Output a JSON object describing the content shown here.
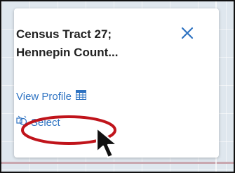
{
  "popup": {
    "title_line1": "Census Tract 27;",
    "title_line2": "Hennepin Count...",
    "close_icon": "close-icon",
    "view_profile_label": "View Profile",
    "view_profile_icon": "table-icon",
    "select_label": "Select",
    "select_icon": "select-features-icon"
  },
  "colors": {
    "link": "#2e73c2",
    "annotation": "#c0141b",
    "title": "#222222"
  }
}
